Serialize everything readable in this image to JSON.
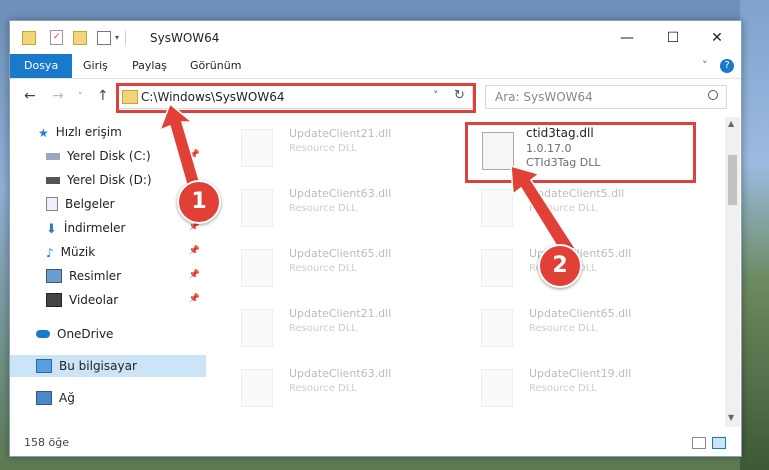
{
  "window": {
    "title": "SysWOW64",
    "controls": {
      "minimize": "—",
      "maximize": "☐",
      "close": "✕"
    }
  },
  "ribbon": {
    "tabs": [
      "Dosya",
      "Giriş",
      "Paylaş",
      "Görünüm"
    ],
    "help_glyph": "?",
    "expand_glyph": "˅"
  },
  "nav": {
    "back": "←",
    "forward": "→",
    "dropdown": "˅",
    "up": "↑",
    "address": "C:\\Windows\\SysWOW64",
    "refresh": "↻",
    "search_placeholder": "Ara: SysWOW64"
  },
  "sidebar": {
    "items": [
      {
        "label": "Hızlı erişim",
        "icon": "star-icon"
      },
      {
        "label": "Yerel Disk (C:)",
        "icon": "drive-icon"
      },
      {
        "label": "Yerel Disk (D:)",
        "icon": "drive-icon"
      },
      {
        "label": "Belgeler",
        "icon": "documents-icon"
      },
      {
        "label": "İndirmeler",
        "icon": "downloads-icon"
      },
      {
        "label": "Müzik",
        "icon": "music-icon"
      },
      {
        "label": "Resimler",
        "icon": "pictures-icon"
      },
      {
        "label": "Videolar",
        "icon": "videos-icon"
      },
      {
        "label": "OneDrive",
        "icon": "cloud-icon"
      },
      {
        "label": "Bu bilgisayar",
        "icon": "computer-icon"
      },
      {
        "label": "Ağ",
        "icon": "network-icon"
      }
    ]
  },
  "files": {
    "left": [
      {
        "name": "UpdateClient21.dll",
        "desc": "Resource DLL"
      },
      {
        "name": "UpdateClient63.dll",
        "desc": "Resource DLL"
      },
      {
        "name": "UpdateClient65.dll",
        "desc": "Resource DLL"
      },
      {
        "name": "UpdateClient21.dll",
        "desc": "Resource DLL"
      },
      {
        "name": "UpdateClient63.dll",
        "desc": "Resource DLL"
      }
    ],
    "highlighted": {
      "name": "ctid3tag.dll",
      "version": "1.0.17.0",
      "desc": "CTId3Tag DLL"
    },
    "right": [
      {
        "name": "UpdateClient5.dll",
        "desc": "Resource DLL"
      },
      {
        "name": "UpdateClient65.dll",
        "desc": "Resource DLL"
      },
      {
        "name": "UpdateClient65.dll",
        "desc": "Resource DLL"
      },
      {
        "name": "UpdateClient19.dll",
        "desc": "Resource DLL"
      }
    ]
  },
  "status": {
    "count": "158 öğe"
  },
  "annotations": {
    "step1": "1",
    "step2": "2"
  },
  "colors": {
    "accent": "#1979ca",
    "highlight": "#d9433b"
  }
}
